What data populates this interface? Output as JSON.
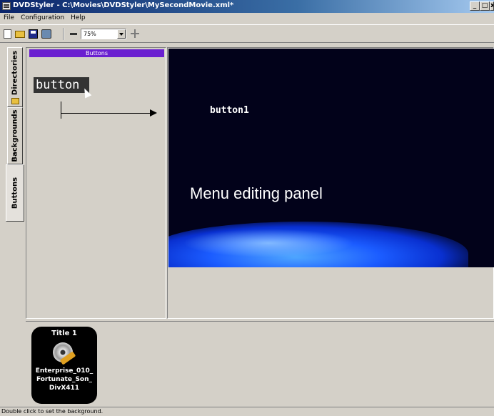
{
  "window": {
    "title": "DVDStyler - C:\\Movies\\DVDStyler\\MySecondMovie.xml*",
    "controls": {
      "minimize": "_",
      "maximize": "□",
      "close": "x"
    }
  },
  "menubar": {
    "items": [
      "File",
      "Configuration",
      "Help"
    ]
  },
  "toolbar": {
    "zoom_value": "75%",
    "icons": [
      "new-file-icon",
      "open-folder-icon",
      "save-icon",
      "settings-icon",
      "zoom-out-icon",
      "zoom-in-icon"
    ]
  },
  "side_tabs": [
    {
      "label": "Directories",
      "active": false
    },
    {
      "label": "Backgrounds",
      "active": false
    },
    {
      "label": "Buttons",
      "active": true
    }
  ],
  "left_panel": {
    "header": "Buttons",
    "items": [
      {
        "label": "button"
      }
    ]
  },
  "canvas": {
    "button_label": "button1",
    "annotation": "Menu editing panel",
    "background_color": "#02021a"
  },
  "titleset": {
    "items": [
      {
        "title": "Title 1",
        "file": "Enterprise_010_ Fortunate_Son_ DivX411"
      }
    ]
  },
  "statusbar": {
    "text": "Double click to set the background."
  }
}
